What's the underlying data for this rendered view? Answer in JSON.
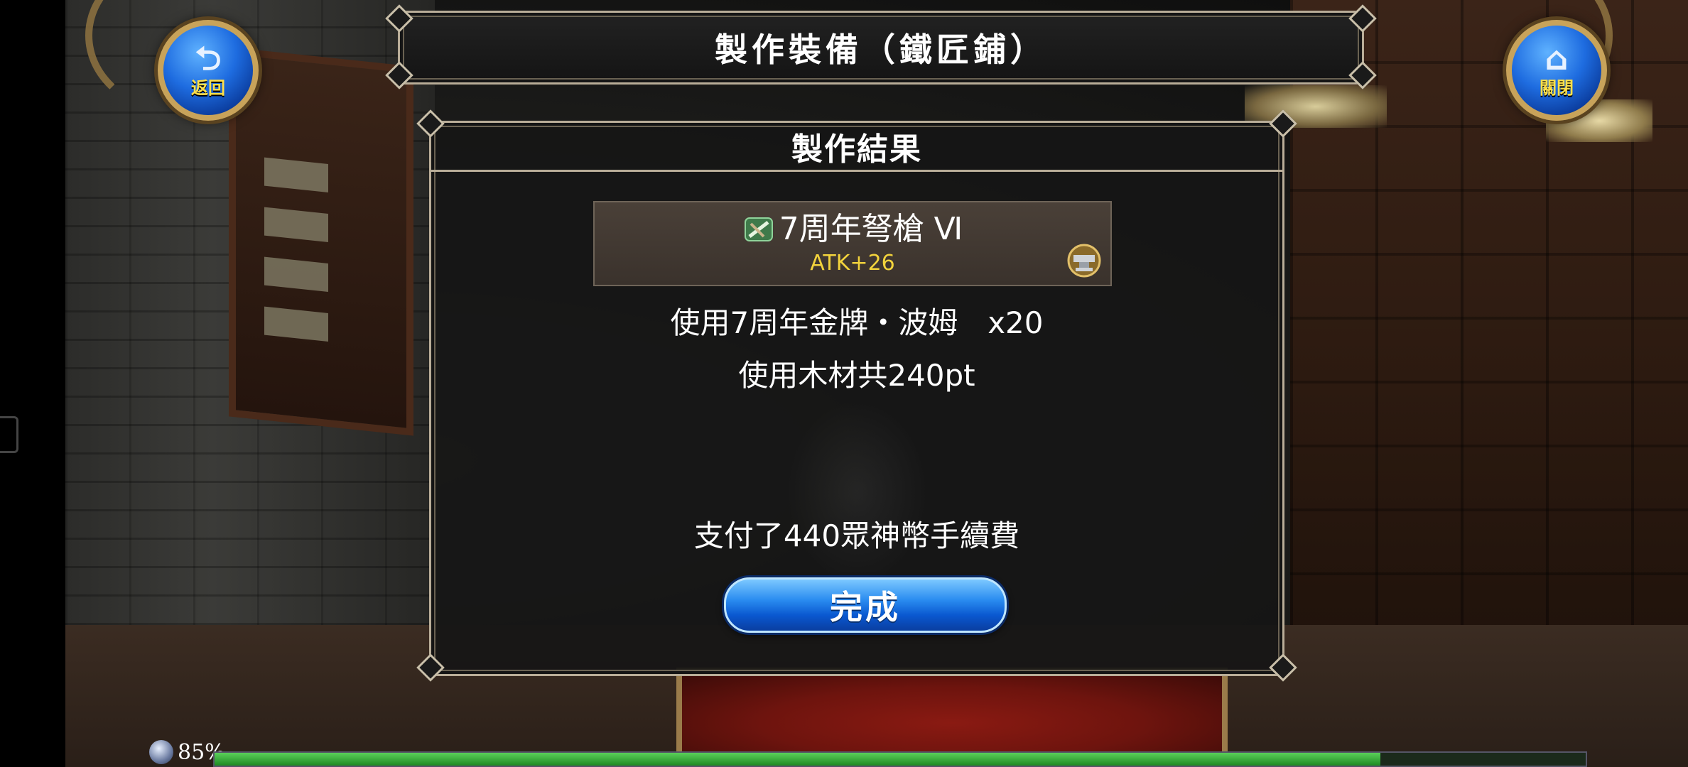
{
  "header": {
    "title": "製作裝備（鐵匠鋪）"
  },
  "nav": {
    "back": {
      "label": "返回",
      "icon": "back-arrow-icon"
    },
    "close": {
      "label": "關閉",
      "icon": "home-icon"
    }
  },
  "result_panel": {
    "title": "製作結果",
    "item": {
      "name": "7周年弩槍 Ⅵ",
      "stat": "ATK+26",
      "type_icon": "crossbow-icon",
      "badge_icon": "anvil-icon"
    },
    "materials_line": "使用7周年金牌・波姆　x20",
    "wood_line": "使用木材共240pt",
    "fee_line": "支付了440眾神幣手續費",
    "done_label": "完成"
  },
  "loading": {
    "percent_label": "85%",
    "progress": 0.85
  },
  "colors": {
    "button_blue": "#1e6ce0",
    "stat_yellow": "#f2d33c",
    "frame_gold": "#c8a35a"
  }
}
